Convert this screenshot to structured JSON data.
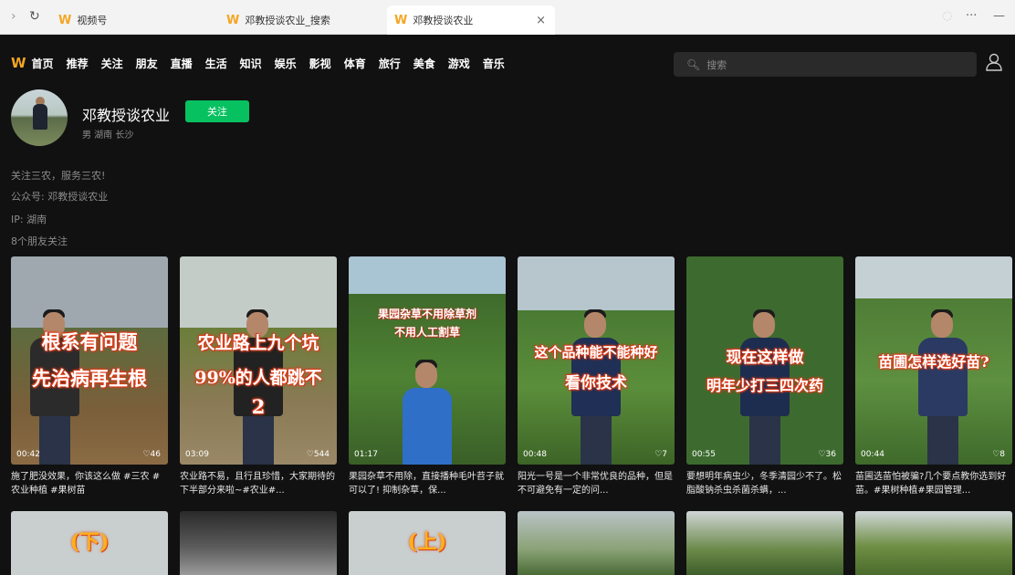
{
  "browser": {
    "tabs": [
      {
        "label": "视频号",
        "active": false
      },
      {
        "label": "邓教授谈农业_搜索",
        "active": false
      },
      {
        "label": "邓教授谈农业",
        "active": true
      }
    ],
    "close_glyph": "×",
    "more_glyph": "···",
    "minimize_glyph": "—"
  },
  "nav": {
    "logo": "὏A",
    "items": [
      "首页",
      "推荐",
      "关注",
      "朋友",
      "直播",
      "生活",
      "知识",
      "娱乐",
      "影视",
      "体育",
      "旅行",
      "美食",
      "游戏",
      "音乐"
    ],
    "search_placeholder": "搜索"
  },
  "profile": {
    "name": "邓教授谈农业",
    "follow_label": "关注",
    "meta": "男  湖南 长沙",
    "bio": [
      "关注三农，服务三农!",
      "公众号: 邓教授谈农业",
      "IP: 湖南",
      "8个朋友关注"
    ]
  },
  "videos": [
    {
      "overlay1": "根系有问题",
      "overlay2": "先治病再生根",
      "duration": "00:42",
      "likes": "♡46",
      "caption": "施了肥没效果，你该这么做 #三农 #农业种植 #果树苗"
    },
    {
      "overlay1": "农业路上九个坑",
      "overlay2": "99%的人都跳不",
      "overlay3": "2",
      "duration": "03:09",
      "likes": "♡544",
      "caption": "农业路不易，且行且珍惜，大家期待的下半部分来啦~#农业#..."
    },
    {
      "overlay1": "果园杂草不用除草剂",
      "overlay2": "不用人工割草",
      "duration": "01:17",
      "likes": "",
      "caption": "果园杂草不用除，直接播种毛叶苕子就可以了! 抑制杂草，保..."
    },
    {
      "overlay1": "这个品种能不能种好",
      "overlay2": "看你技术",
      "duration": "00:48",
      "likes": "♡7",
      "caption": "阳光一号是一个非常优良的品种，但是不可避免有一定的问..."
    },
    {
      "overlay1": "现在这样做",
      "overlay2": "明年少打三四次药",
      "duration": "00:55",
      "likes": "♡36",
      "caption": "要想明年病虫少，冬季清园少不了。松脂酸钠杀虫杀菌杀螨，..."
    },
    {
      "overlay1": "苗圃怎样选好苗?",
      "overlay2": "",
      "duration": "00:44",
      "likes": "♡8",
      "caption": "苗圃选苗怕被骗?几个要点教你选到好苗。#果树种植#果园管理..."
    }
  ],
  "row2": [
    {
      "overlay": "(下)"
    },
    {
      "overlay": ""
    },
    {
      "overlay": "(上)"
    },
    {
      "overlay": ""
    },
    {
      "overlay": ""
    },
    {
      "overlay": ""
    }
  ]
}
